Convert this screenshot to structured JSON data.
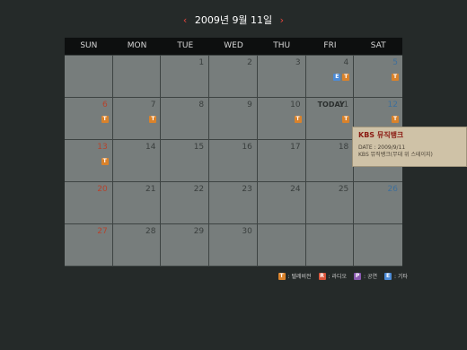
{
  "header": {
    "prev_arrow": "‹",
    "title": "2009년 9월 11일",
    "next_arrow": "›"
  },
  "weekdays": [
    "SUN",
    "MON",
    "TUE",
    "WED",
    "THU",
    "FRI",
    "SAT"
  ],
  "weeks": [
    [
      "",
      "",
      "1",
      "2",
      "3",
      "4",
      "5"
    ],
    [
      "6",
      "7",
      "8",
      "9",
      "10",
      "11",
      "12"
    ],
    [
      "13",
      "14",
      "15",
      "16",
      "17",
      "18",
      "19"
    ],
    [
      "20",
      "21",
      "22",
      "23",
      "24",
      "25",
      "26"
    ],
    [
      "27",
      "28",
      "29",
      "30",
      "",
      "",
      ""
    ]
  ],
  "today_label": "TODAY",
  "events": [
    {
      "day": "4",
      "types": [
        "etc",
        "tv"
      ]
    },
    {
      "day": "5",
      "types": [
        "tv"
      ]
    },
    {
      "day": "6",
      "types": [
        "tv"
      ]
    },
    {
      "day": "7",
      "types": [
        "tv"
      ]
    },
    {
      "day": "10",
      "types": [
        "tv"
      ]
    },
    {
      "day": "11",
      "types": [
        "tv"
      ]
    },
    {
      "day": "12",
      "types": [
        "tv"
      ]
    },
    {
      "day": "13",
      "types": [
        "tv"
      ]
    }
  ],
  "badge_letters": {
    "tv": "T",
    "radio": "R",
    "show": "P",
    "etc": "E"
  },
  "tooltip": {
    "title": "KBS 뮤직뱅크",
    "date_line": "DATE : 2009/9/11",
    "desc_line": "KBS 뮤직뱅크(무대 위 스테이지)"
  },
  "legend": [
    {
      "type": "tv",
      "label": "텔레비전"
    },
    {
      "type": "radio",
      "label": "라디오"
    },
    {
      "type": "show",
      "label": "공연"
    },
    {
      "type": "etc",
      "label": "기타"
    }
  ],
  "colors": {
    "tv": "#d9822b",
    "radio": "#d9543a",
    "show": "#8a5ab0",
    "etc": "#4d8bd6"
  }
}
